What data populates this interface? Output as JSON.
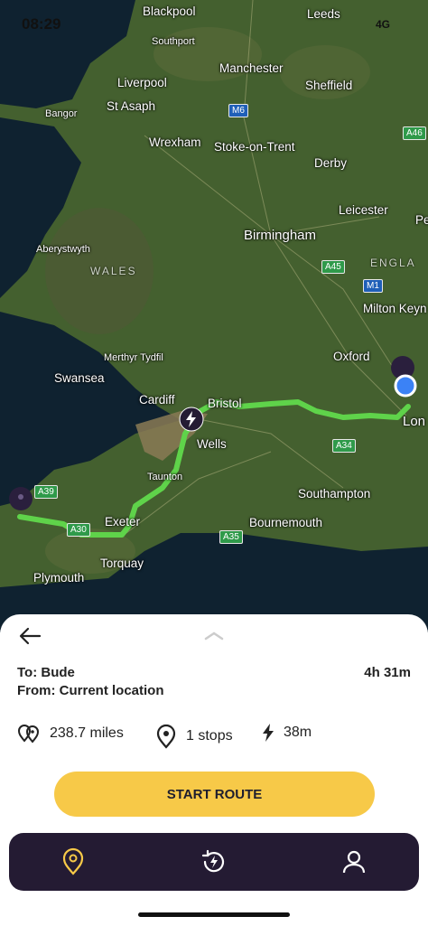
{
  "status": {
    "time": "08:29",
    "network": "4G"
  },
  "map": {
    "places": [
      "Blackpool",
      "Leeds",
      "Southport",
      "Manchester",
      "Liverpool",
      "Sheffield",
      "Bangor",
      "St Asaph",
      "Wrexham",
      "Stoke-on-Trent",
      "Derby",
      "Leicester",
      "Pe",
      "Birmingham",
      "Aberystwyth",
      "Milton Keyn",
      "Merthyr Tydfil",
      "Oxford",
      "Swansea",
      "Cardiff",
      "Bristol",
      "Lon",
      "Wells",
      "Taunton",
      "Southampton",
      "Exeter",
      "Bournemouth",
      "Torquay",
      "Plymouth"
    ],
    "regions": [
      "WALES",
      "ENGLA"
    ],
    "roads": [
      "M6",
      "A46",
      "A45",
      "M1",
      "A34",
      "A39",
      "A35",
      "A30"
    ],
    "route_color": "#5fd34a",
    "origin_color": "#3b82f6"
  },
  "trip": {
    "to": "To: Bude",
    "from": "From: Current location",
    "duration": "4h 31m",
    "distance": "238.7 miles",
    "stops": "1 stops",
    "charge_time": "38m"
  },
  "actions": {
    "start_label": "START ROUTE"
  },
  "colors": {
    "accent": "#f7c948",
    "nav_bg": "#241b33"
  },
  "nav": {
    "icons": [
      "location-pin-icon",
      "history-charge-icon",
      "profile-icon"
    ]
  }
}
